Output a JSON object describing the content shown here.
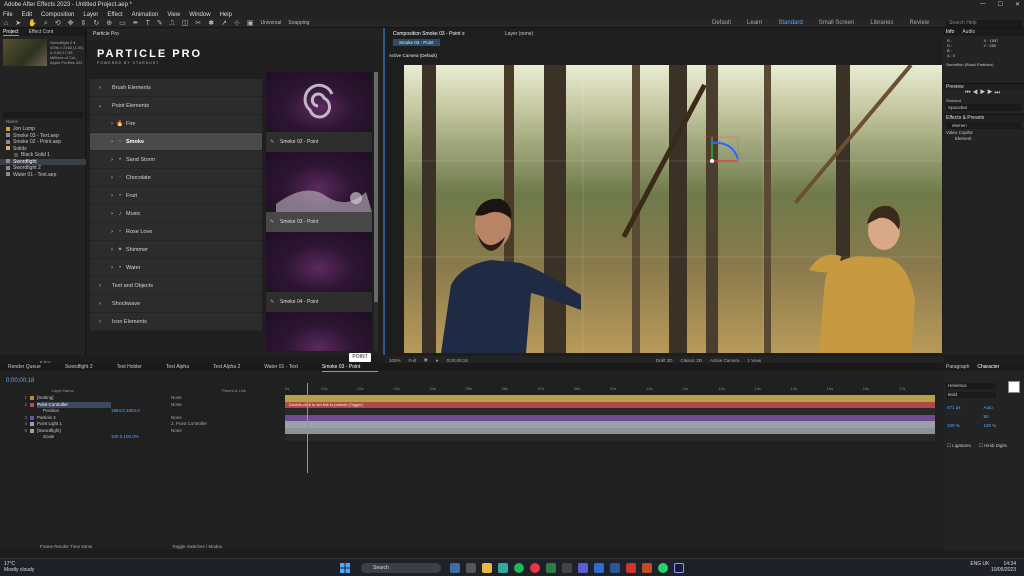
{
  "titlebar": {
    "title": "Adobe After Effects 2023 - Untitled Project.aep *"
  },
  "menu": [
    "File",
    "Edit",
    "Composition",
    "Layer",
    "Effect",
    "Animation",
    "View",
    "Window",
    "Help"
  ],
  "toolbar": {
    "universal": "Universal",
    "snapping": "Snapping"
  },
  "workspaces": [
    "Default",
    "Learn",
    "Standard",
    "Small Screen",
    "Libraries",
    "Review"
  ],
  "workspace_active": "Standard",
  "help_search": {
    "placeholder": "Search Help"
  },
  "project": {
    "tabs": [
      "Project",
      "Effect Cont"
    ],
    "info_lines": [
      "Swordfight 2 ▾",
      "4096 x 2160 (1.00)",
      "Δ 0;00;17;38",
      "Millions of Col...",
      "Apple ProRes 422"
    ],
    "header": "Name",
    "items": [
      {
        "name": "Jon Lump",
        "color": "#c9a04a"
      },
      {
        "name": "Smoke 03 - Text.aep",
        "color": "#8a8a8a"
      },
      {
        "name": "Smoke 02 - Point.aep",
        "color": "#8a8a8a"
      },
      {
        "name": "Solids",
        "color": "#d3b25a"
      },
      {
        "name": "Black Solid 1",
        "color": "#555555"
      },
      {
        "name": "Swordfight",
        "color": "#8a8a8a"
      },
      {
        "name": "Swordfight 2",
        "color": "#8a8a8a"
      },
      {
        "name": "Water 01 - Text.aep",
        "color": "#8a8a8a"
      }
    ],
    "footer": "8 bpc"
  },
  "particle": {
    "header": "Particle Pro",
    "logo": "PARTICLE PRO",
    "logo_sub": "POWERED BY STARDUST",
    "categories": [
      {
        "label": "Brush Elements",
        "indent": 0,
        "chev": "›",
        "icon": ""
      },
      {
        "label": "Point Elements",
        "indent": 0,
        "chev": "⌄",
        "icon": ""
      },
      {
        "label": "Fire",
        "indent": 1,
        "chev": "›",
        "icon": "🔥"
      },
      {
        "label": "Smoke",
        "indent": 1,
        "chev": "›",
        "icon": "~",
        "selected": true
      },
      {
        "label": "Sand Storm",
        "indent": 1,
        "chev": "›",
        "icon": "•"
      },
      {
        "label": "Chocolate",
        "indent": 1,
        "chev": "›",
        "icon": "•"
      },
      {
        "label": "Fruit",
        "indent": 1,
        "chev": "›",
        "icon": "•"
      },
      {
        "label": "Music",
        "indent": 1,
        "chev": "›",
        "icon": "♪"
      },
      {
        "label": "Rose Love",
        "indent": 1,
        "chev": "›",
        "icon": "•"
      },
      {
        "label": "Shimmer",
        "indent": 1,
        "chev": "›",
        "icon": "✦"
      },
      {
        "label": "Water",
        "indent": 1,
        "chev": "›",
        "icon": "•"
      },
      {
        "label": "Text and Objects",
        "indent": 0,
        "chev": "›",
        "icon": ""
      },
      {
        "label": "Shockwave",
        "indent": 0,
        "chev": "›",
        "icon": ""
      },
      {
        "label": "Icon Elements",
        "indent": 0,
        "chev": "›",
        "icon": ""
      }
    ],
    "presets": [
      {
        "label": "Smoke 02 - Point",
        "selected": false
      },
      {
        "label": "Smoke 03 - Point",
        "selected": true
      },
      {
        "label": "Smoke 04 - Point",
        "selected": false
      },
      {
        "label": "",
        "selected": false
      }
    ],
    "point_button": "POINT"
  },
  "comp": {
    "tabs": [
      "Composition Smoke 03 - Point ≡",
      "Layer (none)"
    ],
    "sub_tab": "Smoke 03 - Point",
    "camera": "Active Camera (Default)",
    "controls": [
      "100%",
      "Full",
      "0;00;00;18",
      "Draft 3D",
      "Classic 3D",
      "Active Camera",
      "1 View"
    ]
  },
  "right": {
    "tabs": [
      "Info",
      "Audio"
    ],
    "info": [
      "R :",
      "G :",
      "B :",
      "A : 0",
      "X : 1557",
      "Y : 280"
    ],
    "solid_line": "Swordfish (Black Particles)",
    "preview": "Preview",
    "shortcut_label": "Shortcut",
    "shortcut_value": "Spacebar",
    "effects_header": "Effects & Presets",
    "effects_search": "elemen",
    "effects_items": [
      "Video Copilot",
      "Element"
    ]
  },
  "timeline": {
    "tabs": [
      "Render Queue",
      "Swordfight 2",
      "Text Holder",
      "Text Alpha",
      "Text Alpha 2",
      "Water 01 - Text",
      "Smoke 03 - Point"
    ],
    "active_tab": "Smoke 03 - Point",
    "timecode": "0;00;00;18",
    "ruler": [
      "0s",
      "01s",
      "02s",
      "03s",
      "04s",
      "05s",
      "06s",
      "07s",
      "08s",
      "09s",
      "10s",
      "11s",
      "12s",
      "13s",
      "14s",
      "15s",
      "16s",
      "17s"
    ],
    "columns": {
      "name": "Layer Name",
      "parent": "Parent & Link"
    },
    "layers": [
      {
        "num": "1",
        "name": "[Setting]",
        "parent": "None",
        "color": "#b38a3c"
      },
      {
        "num": "2",
        "name": "Point Controller",
        "parent": "None",
        "color": "#c24a4a",
        "selected": true
      },
      {
        "num": "",
        "name": "Position",
        "parent": "",
        "color": "#202020",
        "value": "1894.0,1854.0"
      },
      {
        "num": "3",
        "name": "Particle 2",
        "parent": "None",
        "color": "#7a4aa0"
      },
      {
        "num": "4",
        "name": "Point Light 1",
        "parent": "2. Point Controller",
        "color": "#a0a0a0"
      },
      {
        "num": "5",
        "name": "[Swordfight]",
        "parent": "None",
        "color": "#a0a0a0"
      },
      {
        "num": "",
        "name": "Scale",
        "parent": "",
        "color": "#202020",
        "value": "100.0,100.0%"
      }
    ],
    "bar_note": "Double-click to set link to particle (Toggle)",
    "footer": [
      "Frame Render Time 84ms",
      "Toggle Switches / Modes"
    ]
  },
  "character": {
    "tabs": [
      "Paragraph",
      "Character"
    ],
    "font": "Helvetica",
    "style": "Bold",
    "size": "471 px",
    "leading": "Auto",
    "tracking": "50",
    "scale_v": "100 %",
    "scale_h": "100 %",
    "options": [
      "Ligatures",
      "Hindi Digits"
    ]
  },
  "taskbar": {
    "weather_temp": "17°C",
    "weather_desc": "Mostly cloudy",
    "search": "Search",
    "lang": "ENG UK",
    "time": "14:34",
    "date": "10/05/2023"
  }
}
